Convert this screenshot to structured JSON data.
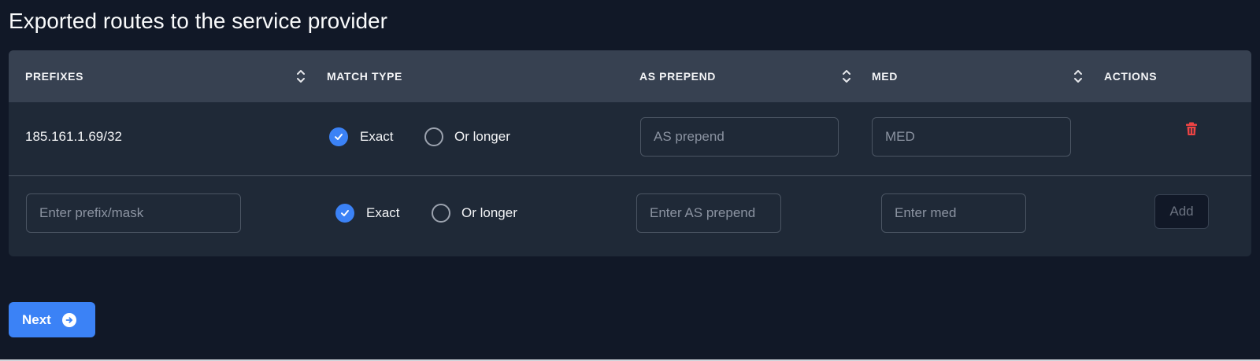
{
  "page": {
    "title": "Exported routes to the service provider"
  },
  "table": {
    "columns": {
      "prefixes": "PREFIXES",
      "match_type": "MATCH TYPE",
      "as_prepend": "AS PREPEND",
      "med": "MED",
      "actions": "ACTIONS"
    },
    "rows": [
      {
        "prefix": "185.161.1.69/32",
        "match_exact": "Exact",
        "match_longer": "Or longer",
        "selected_match": "Exact",
        "as_prepend_placeholder": "AS prepend",
        "med_placeholder": "MED"
      }
    ],
    "new_row": {
      "prefix_placeholder": "Enter prefix/mask",
      "match_exact": "Exact",
      "match_longer": "Or longer",
      "selected_match": "Exact",
      "as_prepend_placeholder": "Enter AS prepend",
      "med_placeholder": "Enter med",
      "add_label": "Add"
    }
  },
  "footer": {
    "next_label": "Next"
  },
  "colors": {
    "background": "#111827",
    "card": "#1f2937",
    "header": "#374151",
    "accent": "#3b82f6",
    "danger": "#ef4444"
  },
  "icons": [
    "sort-icon",
    "check-icon",
    "trash-icon",
    "arrow-circle-right-icon"
  ]
}
